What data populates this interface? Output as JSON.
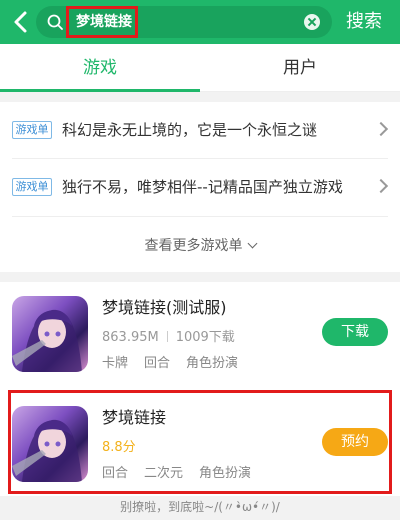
{
  "header": {
    "query": "梦境链接",
    "search_button": "搜索",
    "accent": "#1fb76a"
  },
  "tabs": [
    {
      "label": "游戏",
      "active": true
    },
    {
      "label": "用户",
      "active": false
    }
  ],
  "game_lists": [
    {
      "badge": "游戏单",
      "title": "科幻是永无止境的，它是一个永恒之谜"
    },
    {
      "badge": "游戏单",
      "title": "独行不易，唯梦相伴--记精品国产独立游戏"
    }
  ],
  "more_lists": "查看更多游戏单",
  "games": [
    {
      "title": "梦境链接(测试服)",
      "size": "863.95M",
      "downloads": "1009下载",
      "tags": [
        "卡牌",
        "回合",
        "角色扮演"
      ],
      "action": "下载"
    },
    {
      "title": "梦境链接",
      "score": "8.8分",
      "tags": [
        "回合",
        "二次元",
        "角色扮演"
      ],
      "action": "预约"
    }
  ],
  "footer": "别撩啦，到底啦~/(〃•̀ω•́〃)/"
}
